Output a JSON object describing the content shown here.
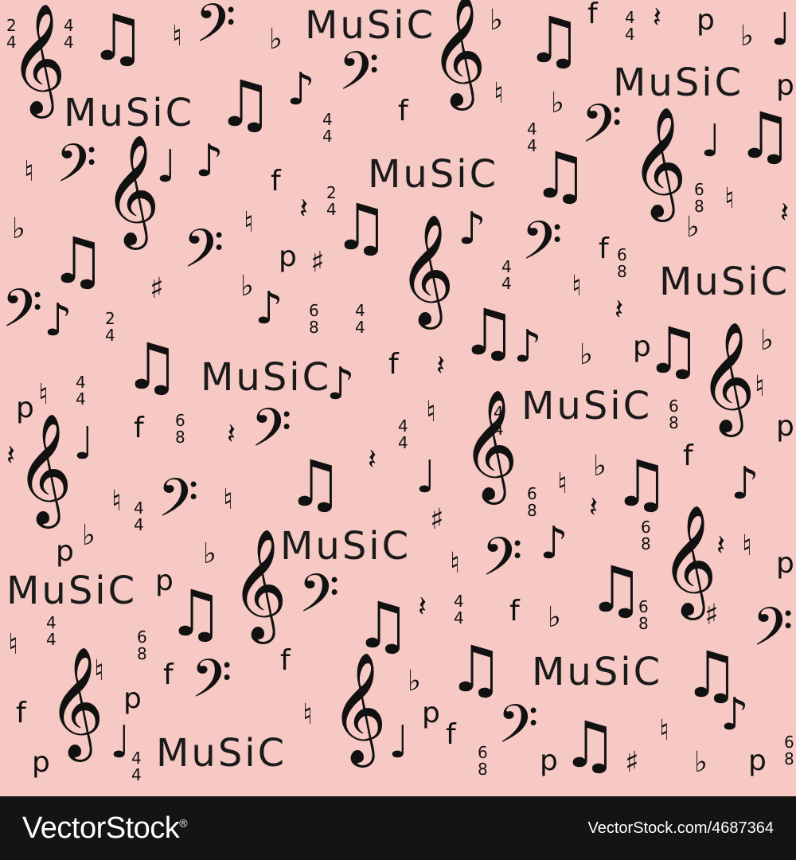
{
  "pattern": {
    "background_color": "#f7c9c4",
    "ink_color": "#111111",
    "words": [
      "MuSiC",
      "MuSiC",
      "MuSiC",
      "MuSiC",
      "MuSiC",
      "MuSiC",
      "MuSiC",
      "MuSiC",
      "MuSiC",
      "MuSiC"
    ],
    "symbols": {
      "treble_clef": "𝄞",
      "bass_clef": "𝄢",
      "beamed_notes": "♫",
      "quarter_note": "♩",
      "eighth_note": "♪",
      "flat": "♭",
      "natural": "♮",
      "sharp": "♯",
      "rest": "𝄽",
      "forte": "f",
      "piano": "p"
    },
    "time_signatures": [
      {
        "top": "2",
        "bottom": "4"
      },
      {
        "top": "4",
        "bottom": "4"
      },
      {
        "top": "6",
        "bottom": "8"
      }
    ]
  },
  "footer": {
    "background_color": "#141414",
    "brand": "VectorStock",
    "brand_mark": "®",
    "image_id": "VectorStock.com/4687364"
  }
}
